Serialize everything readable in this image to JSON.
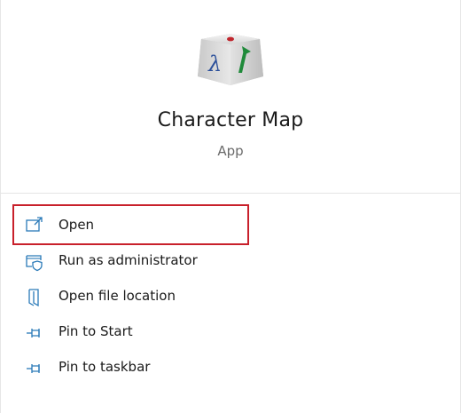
{
  "app": {
    "name": "Character Map",
    "type": "App",
    "icon": "character-map-icon"
  },
  "menu": {
    "highlight_color": "#c8202b",
    "icon_color": "#2a7ab8",
    "items": [
      {
        "label": "Open",
        "icon": "open-window-icon",
        "highlighted": true
      },
      {
        "label": "Run as administrator",
        "icon": "shield-window-icon",
        "highlighted": false
      },
      {
        "label": "Open file location",
        "icon": "folder-location-icon",
        "highlighted": false
      },
      {
        "label": "Pin to Start",
        "icon": "pin-icon",
        "highlighted": false
      },
      {
        "label": "Pin to taskbar",
        "icon": "pin-icon",
        "highlighted": false
      }
    ]
  }
}
